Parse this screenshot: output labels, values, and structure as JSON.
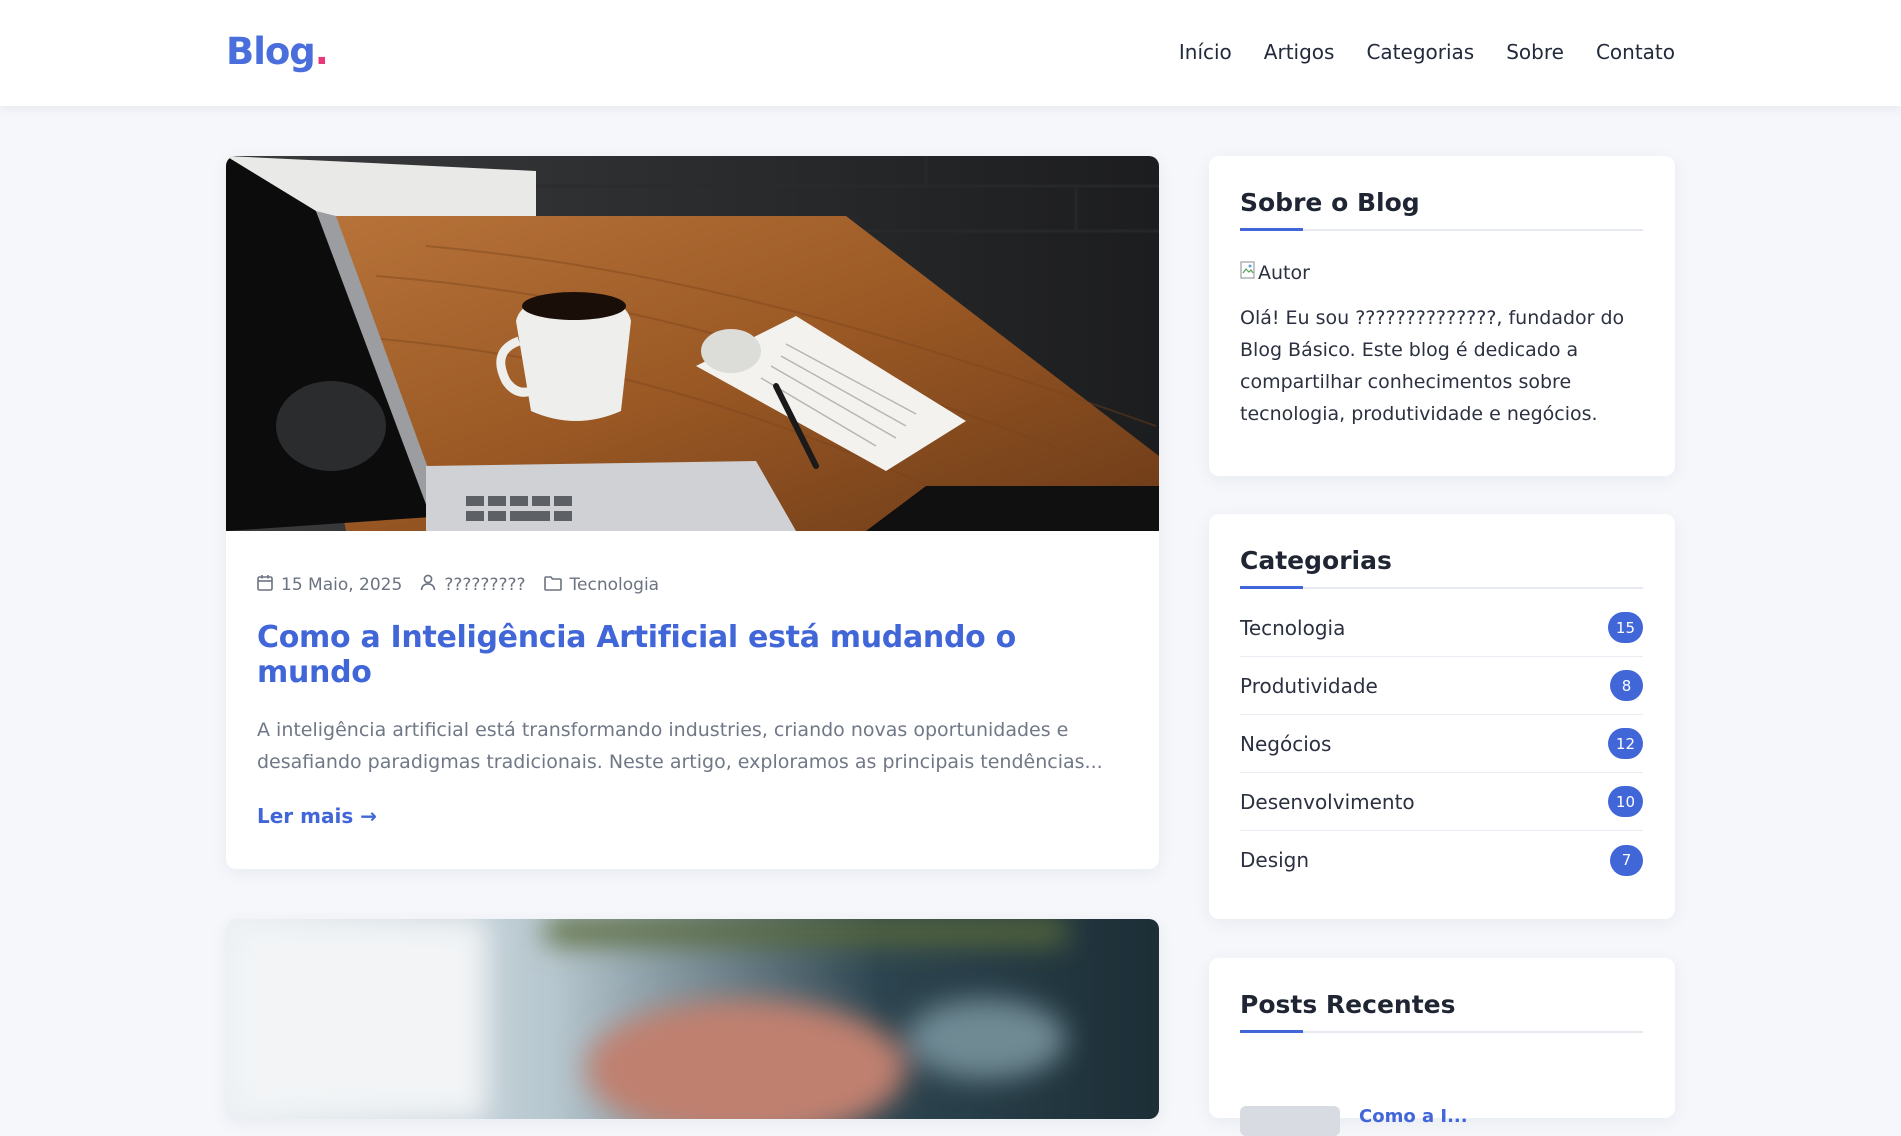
{
  "brand": {
    "name": "Blog",
    "dot": ".",
    "colors": {
      "primary": "#4a6fdc",
      "accent": "#e5397a",
      "link": "#4166d8"
    }
  },
  "nav": [
    {
      "label": "Início"
    },
    {
      "label": "Artigos"
    },
    {
      "label": "Categorias"
    },
    {
      "label": "Sobre"
    },
    {
      "label": "Contato"
    }
  ],
  "posts": [
    {
      "date": "15 Maio, 2025",
      "author": "?????????",
      "category": "Tecnologia",
      "title": "Como a Inteligência Artificial está mudando o mundo",
      "excerpt": "A inteligência artificial está transformando industries, criando novas oportunidades e desafiando paradigmas tradicionais. Neste artigo, exploramos as principais tendências...",
      "read_more": "Ler mais →",
      "image": "desk-with-laptop-coffee-notepad"
    },
    {
      "image": "blurred-hands-typing-laptop"
    }
  ],
  "sidebar": {
    "about": {
      "title": "Sobre o Blog",
      "avatar_alt": "Autor",
      "text": "Olá! Eu sou ??????????????, fundador do Blog Básico. Este blog é dedicado a compartilhar conhecimentos sobre tecnologia, produtividade e negócios."
    },
    "categories": {
      "title": "Categorias",
      "items": [
        {
          "label": "Tecnologia",
          "count": "15"
        },
        {
          "label": "Produtividade",
          "count": "8"
        },
        {
          "label": "Negócios",
          "count": "12"
        },
        {
          "label": "Desenvolvimento",
          "count": "10"
        },
        {
          "label": "Design",
          "count": "7"
        }
      ]
    },
    "recent": {
      "title": "Posts Recentes",
      "first_title": "Como a I..."
    }
  }
}
